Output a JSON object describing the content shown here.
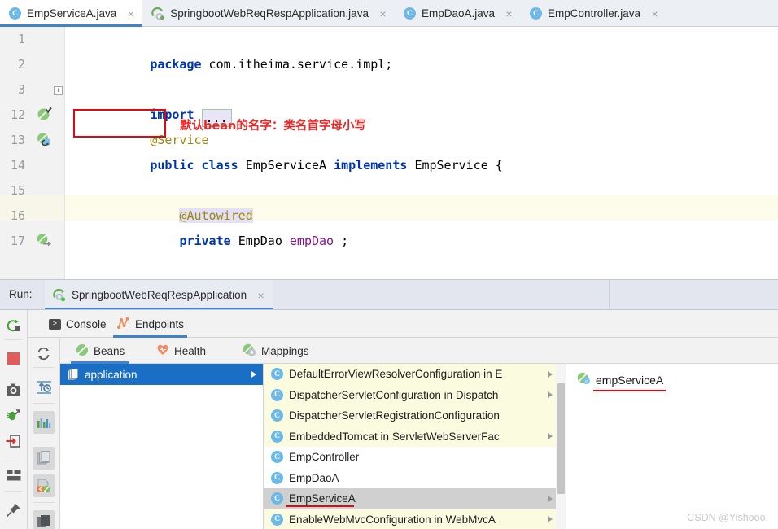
{
  "editor_tabs": [
    {
      "label": "EmpServiceA.java",
      "icon": "java-class-icon",
      "active": true,
      "closable": true
    },
    {
      "label": "SpringbootWebReqRespApplication.java",
      "icon": "spring-boot-app-icon",
      "active": false,
      "closable": true
    },
    {
      "label": "EmpDaoA.java",
      "icon": "java-class-icon",
      "active": false,
      "closable": true
    },
    {
      "label": "EmpController.java",
      "icon": "java-class-icon",
      "active": false,
      "closable": true
    }
  ],
  "editor": {
    "lines": [
      {
        "number": "1",
        "text": "package com.itheima.service.impl;"
      },
      {
        "number": "2",
        "text": ""
      },
      {
        "number": "3",
        "text": "import ..."
      },
      {
        "number": "12",
        "text": "@Service"
      },
      {
        "number": "13",
        "text": "public class EmpServiceA implements EmpService {"
      },
      {
        "number": "14",
        "text": ""
      },
      {
        "number": "15",
        "text": "    @Autowired"
      },
      {
        "number": "16",
        "text": "    private EmpDao empDao ;"
      },
      {
        "number": "17",
        "text": ""
      }
    ],
    "tokens": {
      "kw_package": "package",
      "pkg_name": " com.itheima.service.impl;",
      "kw_import": "import ",
      "fold_placeholder": "...",
      "annotation_service": "@Service",
      "kw_public": "public",
      "kw_class": "class",
      "class_name": "EmpServiceA",
      "kw_implements": "implements",
      "interface_name": "EmpService",
      "brace_open": "{",
      "annotation_autowired": "@Autowired",
      "kw_private": "private",
      "type_empdao": "EmpDao",
      "field_empdao": "empDao",
      "semicolon": ";"
    },
    "annotation_note": "默认bean的名字：类名首字母小写",
    "note_color": "#ef2626",
    "highlight_box_color": "#e30613"
  },
  "run_panel": {
    "run_label": "Run:",
    "configuration_name": "SpringbootWebReqRespApplication",
    "configuration_icon": "spring-boot-run-icon",
    "close_icon": "×",
    "sub_tabs": [
      {
        "label": "Console",
        "icon": "console-icon",
        "active": false
      },
      {
        "label": "Endpoints",
        "icon": "endpoints-icon",
        "active": true
      }
    ],
    "endpoint_tabs": [
      {
        "label": "Beans",
        "icon": "bean-icon",
        "active": true
      },
      {
        "label": "Health",
        "icon": "health-heart-icon",
        "active": false
      },
      {
        "label": "Mappings",
        "icon": "mappings-icon",
        "active": false
      }
    ],
    "left_toolbar": [
      {
        "name": "rerun-icon",
        "glyph": "rerun"
      },
      {
        "name": "stop-icon",
        "glyph": "stop"
      },
      {
        "name": "camera-icon",
        "glyph": "camera"
      },
      {
        "name": "debug-icon",
        "glyph": "debug"
      },
      {
        "name": "import-icon",
        "glyph": "import"
      },
      {
        "name": "layout-icon",
        "glyph": "layout"
      },
      {
        "name": "pin-icon",
        "glyph": "pin"
      }
    ],
    "second_toolbar": [
      {
        "name": "refresh-icon",
        "glyph": "refresh"
      },
      {
        "name": "timeline-icon",
        "glyph": "timeline"
      },
      {
        "name": "chart-icon",
        "glyph": "chart"
      },
      {
        "name": "copy-icon",
        "glyph": "copy"
      },
      {
        "name": "diagram-icon",
        "glyph": "diagram"
      },
      {
        "name": "stack-icon",
        "glyph": "stack"
      }
    ],
    "tree": {
      "items": [
        {
          "label": "application",
          "icon": "application-icon",
          "selected": true,
          "has_children": true
        }
      ]
    },
    "bean_list": [
      {
        "label": "DefaultErrorViewResolverConfiguration in E",
        "highlighted": true,
        "selected": false,
        "has_arrow": true
      },
      {
        "label": "DispatcherServletConfiguration in Dispatch",
        "highlighted": true,
        "selected": false,
        "has_arrow": true
      },
      {
        "label": "DispatcherServletRegistrationConfiguration",
        "highlighted": true,
        "selected": false,
        "has_arrow": true
      },
      {
        "label": "EmbeddedTomcat in ServletWebServerFac",
        "highlighted": true,
        "selected": false,
        "has_arrow": true
      },
      {
        "label": "EmpController",
        "highlighted": false,
        "selected": false,
        "has_arrow": false
      },
      {
        "label": "EmpDaoA",
        "highlighted": false,
        "selected": false,
        "has_arrow": false
      },
      {
        "label": "EmpServiceA",
        "highlighted": false,
        "selected": true,
        "has_arrow": true
      },
      {
        "label": "EnableWebMvcConfiguration in WebMvcA",
        "highlighted": true,
        "selected": false,
        "has_arrow": true
      }
    ],
    "detail": {
      "bean_name": "empServiceA",
      "icon": "spring-bean-icon",
      "underline_color": "#e30613"
    }
  },
  "watermark": "CSDN @Yishooo."
}
